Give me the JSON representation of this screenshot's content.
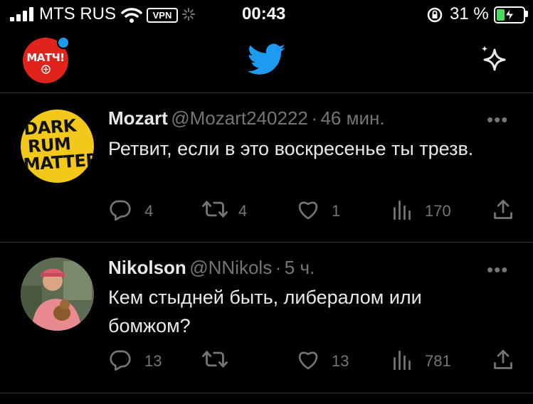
{
  "status_bar": {
    "carrier": "MTS RUS",
    "vpn": "VPN",
    "time": "00:43",
    "battery": "31 %",
    "battery_fraction": 0.31
  },
  "header": {
    "logo_text": "МАТЧ!",
    "compose_icon": "sparkle-icon",
    "app_icon": "twitter-bird-icon"
  },
  "tweets": [
    {
      "name": "Mozart",
      "handle": "@Mozart240222",
      "sep": "·",
      "time": "46 мин.",
      "text": "Ретвит, если в это воскресенье ты трезв.",
      "replies": "4",
      "retweets": "4",
      "likes": "1",
      "views": "170",
      "avatar_text": [
        "DARK",
        "RUM",
        "MATTER"
      ]
    },
    {
      "name": "Nikolson",
      "handle": "@NNikols",
      "sep": "·",
      "time": "5 ч.",
      "text": "Кем стыдней быть, либералом или бомжом?",
      "replies": "13",
      "retweets": "",
      "likes": "13",
      "views": "781"
    }
  ],
  "colors": {
    "accent": "#1d9bf0",
    "background": "#000000",
    "muted": "#71767b",
    "divider": "#2f3336"
  }
}
